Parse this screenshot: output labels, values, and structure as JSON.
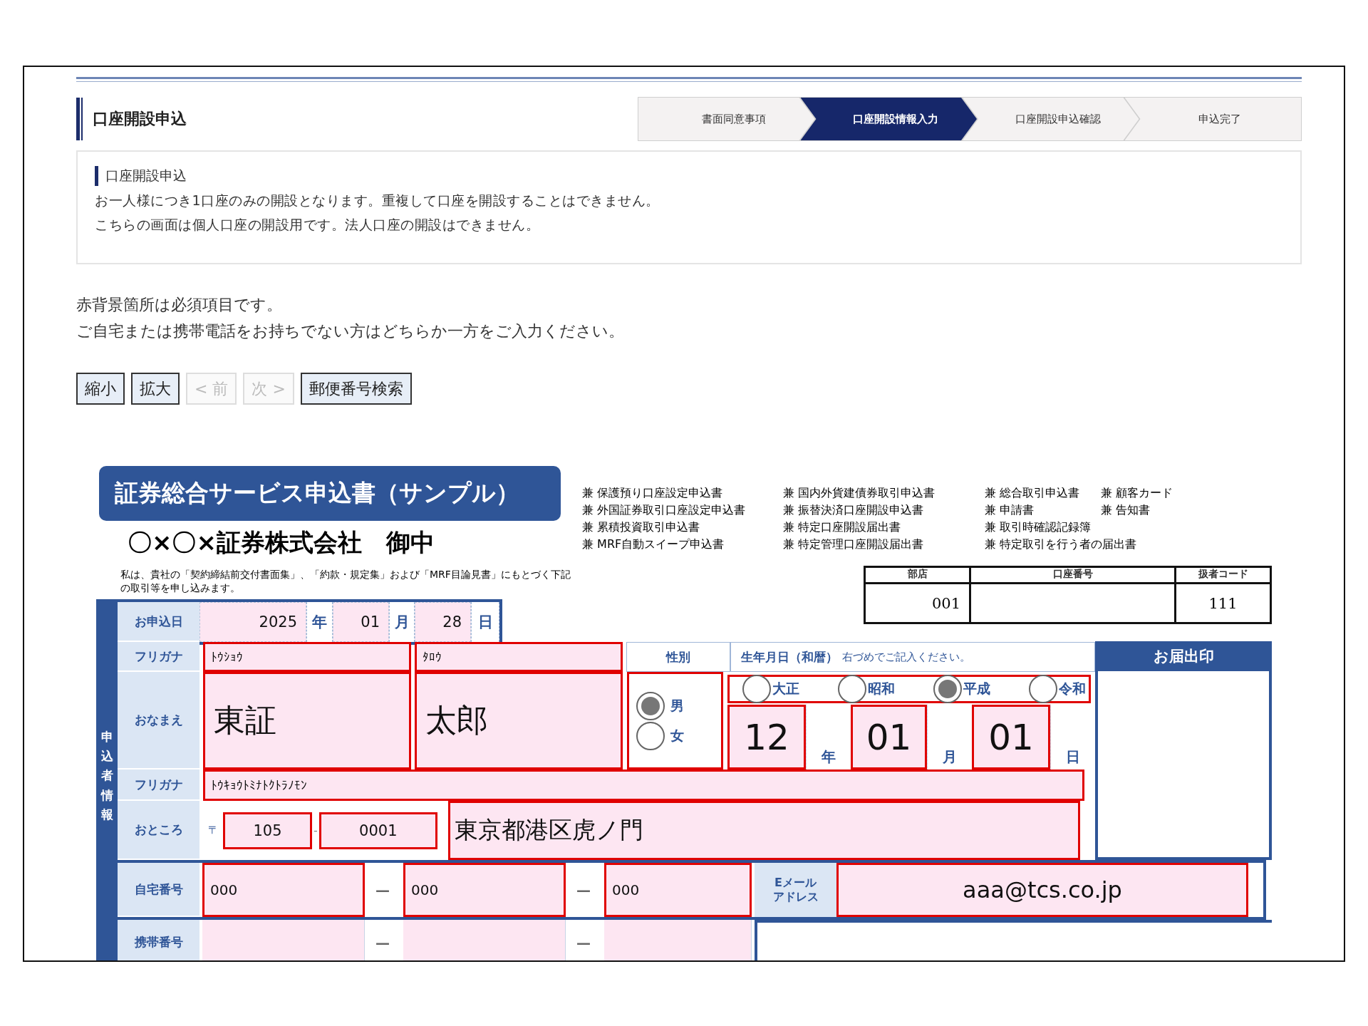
{
  "header": {
    "title": "口座開設申込",
    "steps": [
      {
        "label": "書面同意事項",
        "selected": false
      },
      {
        "label": "口座開設情報入力",
        "selected": true
      },
      {
        "label": "口座開設申込確認",
        "selected": false
      },
      {
        "label": "申込完了",
        "selected": false
      }
    ]
  },
  "info": {
    "heading": "口座開設申込",
    "lines": [
      "お一人様につき1口座のみの開設となります。重複して口座を開設することはできません。",
      "こちらの画面は個人口座の開設用です。法人口座の開設はできません。"
    ]
  },
  "notes": [
    "赤背景箇所は必須項目です。",
    "ご自宅または携帯電話をお持ちでない方はどちらか一方をご入力ください。"
  ],
  "toolbar": [
    {
      "label": "縮小",
      "disabled": false
    },
    {
      "label": "拡大",
      "disabled": false
    },
    {
      "label": "< 前",
      "disabled": true
    },
    {
      "label": "次 >",
      "disabled": true
    },
    {
      "label": "郵便番号検索",
      "disabled": false
    }
  ],
  "form": {
    "title": "証券総合サービス申込書（サンプル）",
    "addressee": "〇×〇×証券株式会社　御中",
    "document_list": [
      [
        "兼 保護預り口座設定申込書",
        "兼 外国証券取引口座設定申込書",
        "兼 累積投資取引申込書",
        "兼 MRF自動スイープ申込書"
      ],
      [
        "兼 国内外貨建債券取引申込書",
        "兼 振替決済口座開設申込書",
        "兼 特定口座開設届出書",
        "兼 特定管理口座開設届出書"
      ],
      [
        "兼 総合取引申込書",
        "兼 申請書",
        "兼 取引時確認記録簿",
        "兼 特定取引を行う者の届出書"
      ],
      [
        "兼 顧客カード",
        "兼 告知書"
      ]
    ],
    "declaration": "私は、貴社の「契約締結前交付書面集」、「約款・規定集」および「MRF目論見書」にもとづく下記の取引等を申し込みます。",
    "account_table": [
      {
        "heading": "部店",
        "value": "001"
      },
      {
        "heading": "口座番号"
      },
      {
        "heading": "扱者コード",
        "value": "111"
      }
    ],
    "side_label": "申込者情報",
    "application_date": {
      "label": "お申込日",
      "required": false,
      "year": "2025",
      "year_unit": "年",
      "month": "01",
      "month_unit": "月",
      "day": "28",
      "day_unit": "日"
    },
    "name_kana": {
      "label": "フリガナ",
      "required": true,
      "surname": "ﾄｳｼｮｳ",
      "given": "ﾀﾛｳ"
    },
    "name": {
      "label": "おなまえ",
      "required": true,
      "surname": "東証",
      "given": "太郎"
    },
    "gender": {
      "label": "性別",
      "required": true,
      "options": [
        {
          "label": "男",
          "selected": true
        },
        {
          "label": "女",
          "selected": false
        }
      ]
    },
    "birth": {
      "label": "生年月日（和暦）",
      "hint": "右づめでご記入ください。",
      "required": true,
      "eras": [
        {
          "label": "大正",
          "selected": false
        },
        {
          "label": "昭和",
          "selected": false
        },
        {
          "label": "平成",
          "selected": true
        },
        {
          "label": "令和",
          "selected": false
        }
      ],
      "year": "12",
      "year_unit": "年",
      "month": "01",
      "month_unit": "月",
      "day": "01",
      "day_unit": "日"
    },
    "seal": {
      "label": "お届出印"
    },
    "address_kana": {
      "label": "フリガナ",
      "required": true,
      "value": "ﾄｳｷｮｳﾄﾐﾅﾄｸﾄﾗﾉﾓﾝ"
    },
    "address": {
      "label": "おところ",
      "required": true,
      "postal_mark": "〒",
      "postal_first": "105",
      "separator": "-",
      "postal_second": "0001",
      "value": "東京都港区虎ノ門"
    },
    "home_phone": {
      "label": "自宅番号",
      "required": true,
      "parts": [
        "000",
        "000",
        "000"
      ],
      "separators": [
        "—",
        "—"
      ]
    },
    "email": {
      "label_lines": [
        "Eメール",
        "アドレス"
      ],
      "required": true,
      "value": "aaa@tcs.co.jp"
    },
    "mobile_phone": {
      "label": "携帯番号",
      "required": false,
      "separators": [
        "—",
        "—"
      ]
    }
  }
}
